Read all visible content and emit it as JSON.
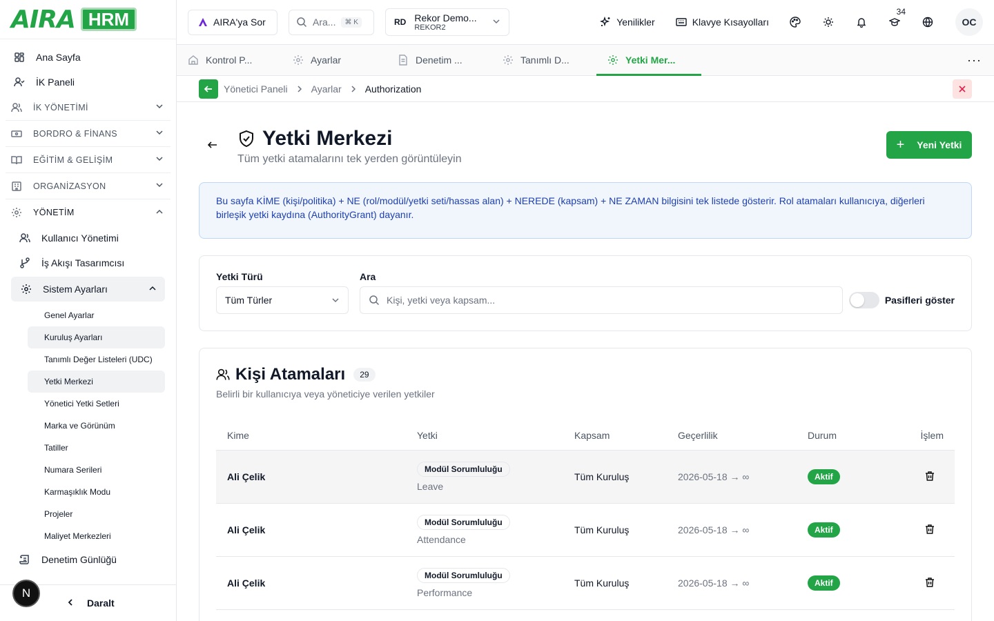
{
  "brand": {
    "name": "AIRA",
    "product": "HRM",
    "color": "#22a447"
  },
  "sidebar": {
    "top_items": [
      {
        "label": "Ana Sayfa",
        "icon": "grid-icon"
      },
      {
        "label": "İK Paneli",
        "icon": "user-check-icon"
      }
    ],
    "groups": [
      {
        "label": "İK YÖNETİMİ",
        "icon": "users-icon",
        "expanded": false
      },
      {
        "label": "BORDRO & FİNANS",
        "icon": "banknote-icon",
        "expanded": false
      },
      {
        "label": "EĞİTİM & GELİŞİM",
        "icon": "book-open-icon",
        "expanded": false
      },
      {
        "label": "ORGANİZASYON",
        "icon": "building-icon",
        "expanded": false
      },
      {
        "label": "YÖNETİM",
        "icon": "gear-icon",
        "expanded": true
      }
    ],
    "management_items": [
      {
        "label": "Kullanıcı Yönetimi",
        "icon": "users-icon"
      },
      {
        "label": "İş Akışı Tasarımcısı",
        "icon": "workflow-icon"
      }
    ],
    "system_settings": {
      "label": "Sistem Ayarları",
      "items": [
        "Genel Ayarlar",
        "Kuruluş Ayarları",
        "Tanımlı Değer Listeleri (UDC)",
        "Yetki Merkezi",
        "Yönetici Yetki Setleri",
        "Marka ve Görünüm",
        "Tatiller",
        "Numara Serileri",
        "Karmaşıklık Modu",
        "Projeler",
        "Maliyet Merkezleri"
      ],
      "active": "Yetki Merkezi"
    },
    "audit_log": "Denetim Günlüğü",
    "collapse_label": "Daralt",
    "dev_badge": "N"
  },
  "topbar": {
    "ask_label": "AIRA'ya Sor",
    "search_placeholder": "Ara...",
    "search_shortcut": "⌘ K",
    "tenant": {
      "initials": "RD",
      "name": "Rekor Demo...",
      "code": "REKOR2"
    },
    "whats_new": "Yenilikler",
    "shortcuts": "Klavye Kısayolları",
    "notification_count": "34",
    "user_initials": "OC"
  },
  "tabs": [
    {
      "label": "Kontrol P...",
      "icon": "home-icon",
      "active": false
    },
    {
      "label": "Ayarlar",
      "icon": "gear-icon",
      "active": false
    },
    {
      "label": "Denetim ...",
      "icon": "file-icon",
      "active": false
    },
    {
      "label": "Tanımlı D...",
      "icon": "gear-icon",
      "active": false
    },
    {
      "label": "Yetki Mer...",
      "icon": "gear-icon",
      "active": true
    }
  ],
  "breadcrumb": [
    "Yönetici Paneli",
    "Ayarlar",
    "Authorization"
  ],
  "page": {
    "title": "Yetki Merkezi",
    "subtitle": "Tüm yetki atamalarını tek yerden görüntüleyin",
    "new_button": "Yeni Yetki",
    "info": "Bu sayfa KİME (kişi/politika) + NE (rol/modül/yetki seti/hassas alan) + NEREDE (kapsam) + NE ZAMAN bilgisini tek listede gösterir. Rol atamaları kullanıcıya, diğerleri birleşik yetki kaydına (AuthorityGrant) dayanır."
  },
  "filters": {
    "type_label": "Yetki Türü",
    "type_value": "Tüm Türler",
    "search_label": "Ara",
    "search_placeholder": "Kişi, yetki veya kapsam...",
    "show_passive_label": "Pasifleri göster",
    "show_passive": false
  },
  "assignments": {
    "title": "Kişi Atamaları",
    "count": "29",
    "subtitle": "Belirli bir kullanıcıya veya yöneticiye verilen yetkiler",
    "columns": [
      "Kime",
      "Yetki",
      "Kapsam",
      "Geçerlilik",
      "Durum",
      "İşlem"
    ],
    "rows": [
      {
        "who": "Ali Çelik",
        "grant": "Modül Sorumluluğu",
        "module": "Leave",
        "scope": "Tüm Kuruluş",
        "validity": "2026-05-18 → ∞",
        "status": "Aktif"
      },
      {
        "who": "Ali Çelik",
        "grant": "Modül Sorumluluğu",
        "module": "Attendance",
        "scope": "Tüm Kuruluş",
        "validity": "2026-05-18 → ∞",
        "status": "Aktif"
      },
      {
        "who": "Ali Çelik",
        "grant": "Modül Sorumluluğu",
        "module": "Performance",
        "scope": "Tüm Kuruluş",
        "validity": "2026-05-18 → ∞",
        "status": "Aktif"
      }
    ]
  }
}
